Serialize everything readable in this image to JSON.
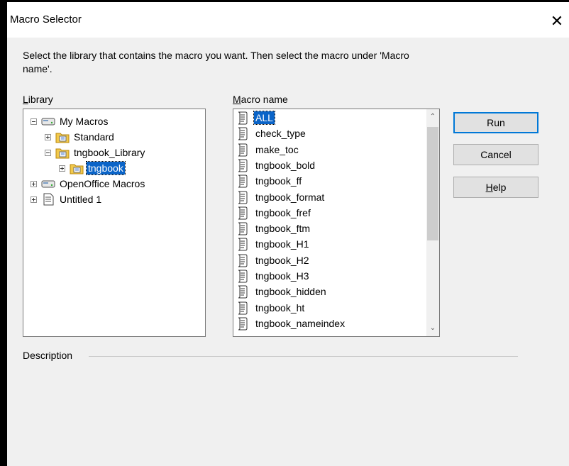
{
  "window": {
    "title": "Macro Selector",
    "close_glyph": "✕"
  },
  "instructions": "Select the library that contains the macro you want. Then select the macro under 'Macro name'.",
  "library": {
    "label_accel": "L",
    "label_rest": "ibrary",
    "nodes": [
      {
        "label": "My Macros",
        "expander": "minus",
        "icon": "macro-container-icon"
      },
      {
        "label": "Standard",
        "expander": "plus",
        "icon": "library-folder-icon"
      },
      {
        "label": "tngbook_Library",
        "expander": "minus",
        "icon": "library-folder-icon"
      },
      {
        "label": "tngbook",
        "expander": "plus",
        "icon": "module-folder-icon",
        "selected": true
      },
      {
        "label": "OpenOffice Macros",
        "expander": "plus",
        "icon": "macro-container-icon"
      },
      {
        "label": "Untitled 1",
        "expander": "plus",
        "icon": "document-icon"
      }
    ]
  },
  "macros": {
    "label_accel": "M",
    "label_rest": "acro name",
    "items": [
      "ALL",
      "check_type",
      "make_toc",
      "tngbook_bold",
      "tngbook_ff",
      "tngbook_format",
      "tngbook_fref",
      "tngbook_ftm",
      "tngbook_H1",
      "tngbook_H2",
      "tngbook_H3",
      "tngbook_hidden",
      "tngbook_ht",
      "tngbook_nameindex"
    ],
    "selected": "ALL",
    "scroll_up": "⌃",
    "scroll_down": "⌄"
  },
  "buttons": {
    "run": "Run",
    "cancel": "Cancel",
    "help_accel": "H",
    "help_rest": "elp"
  },
  "description": {
    "label": "Description"
  },
  "colors": {
    "selection": "#0a64c8",
    "default_button_border": "#0078d7",
    "dialog_bg": "#f0f0f0"
  }
}
